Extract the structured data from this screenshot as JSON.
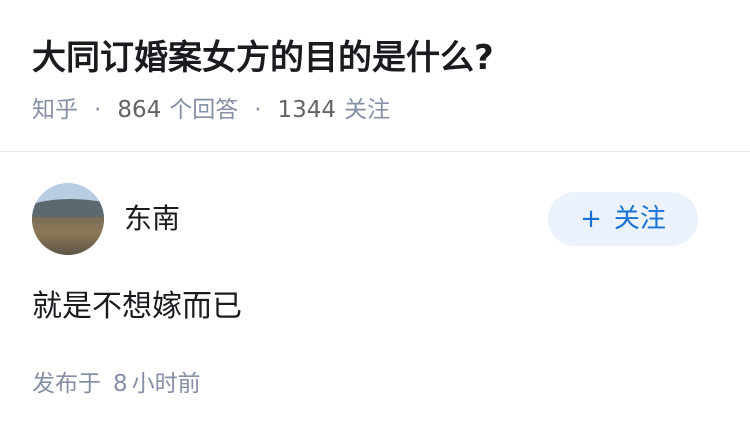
{
  "question": {
    "title": "大同订婚案女方的目的是什么?",
    "source": "知乎",
    "separator": "·",
    "answer_count": "864",
    "answer_label": "个回答",
    "follower_count": "1344",
    "follower_label": "关注"
  },
  "answer": {
    "author_name": "东南",
    "follow_button": {
      "icon": "+",
      "label": "关注"
    },
    "content": "就是不想嫁而已",
    "published_prefix": "发布于",
    "published_num": "8",
    "published_suffix": "小时前"
  },
  "colors": {
    "accent": "#1772d7",
    "muted": "#8590a6",
    "follow_bg": "#ebf2fb"
  }
}
